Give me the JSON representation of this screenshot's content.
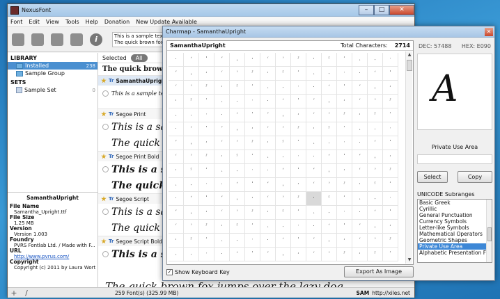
{
  "app": {
    "title": "NexusFont",
    "menu": [
      "Font",
      "Edit",
      "View",
      "Tools",
      "Help",
      "Donation",
      "New Update Available"
    ],
    "sample_text": [
      "This is a sample text",
      "The quick brown fox"
    ]
  },
  "library": {
    "header": "LIBRARY",
    "items": [
      {
        "label": "Installed",
        "count": "238"
      },
      {
        "label": "Sample Group",
        "count": ""
      }
    ],
    "sets_header": "SETS",
    "sets": [
      {
        "label": "Sample Set",
        "count": "0"
      }
    ]
  },
  "font_info": {
    "name": "SamanthaUpright",
    "fields": [
      {
        "label": "File Name",
        "value": "Samantha_Upright.ttf"
      },
      {
        "label": "File Size",
        "value": "1.25 MB"
      },
      {
        "label": "Version",
        "value": "Version 1.003"
      },
      {
        "label": "Foundry",
        "value": "PVRS Fontlab Ltd. / Made with F..."
      },
      {
        "label": "URL",
        "value": "http://www.pvrus.com/"
      },
      {
        "label": "Copyright",
        "value": "Copyright (c) 2011 by Laura Wort..."
      }
    ]
  },
  "font_list": {
    "selected_label": "Selected",
    "all_label": "All",
    "preview_top": "The quick brown f",
    "fonts": [
      {
        "name": "SamanthaUpright",
        "sample": "This is a sample text in"
      },
      {
        "name": "Segoe Print",
        "sample": "This is a sam",
        "sample2": "The quick b"
      },
      {
        "name": "Segoe Print Bold",
        "sample": "This is a sam",
        "sample2": "The quick b"
      },
      {
        "name": "Segoe Script",
        "sample": "This is a sa",
        "sample2": "The quick"
      },
      {
        "name": "Segoe Script Bold",
        "sample": "This is a sa"
      }
    ],
    "bottom_sample": "The quick brown fox jumps over the lazy dog"
  },
  "status": {
    "count": "259 Font(s) (325.99 MB)",
    "sam": "SAM",
    "url": "http://xiles.net"
  },
  "charmap": {
    "title": "Charmap - SamanthaUpright",
    "font_name": "SamanthaUpright",
    "total_label": "Total Characters:",
    "total_value": "2714",
    "dec": "DEC: 57488",
    "hex": "HEX: E090",
    "glyph": "A",
    "range_name": "Private Use Area",
    "select_label": "Select",
    "copy_label": "Copy",
    "subranges_label": "UNICODE Subranges",
    "subranges": [
      "Basic Greek",
      "Cyrillic",
      "General Punctuation",
      "Currency Symbols",
      "Letter-like Symbols",
      "Mathematical Operators",
      "Geometric Shapes",
      "Private Use Area",
      "Alphabetic Presentation Forms"
    ],
    "selected_subrange": "Private Use Area",
    "keyboard_key_label": "Show Keyboard Key",
    "export_label": "Export As Image"
  }
}
